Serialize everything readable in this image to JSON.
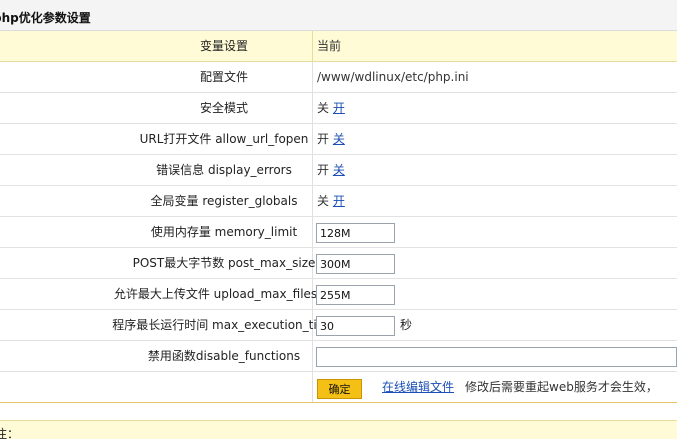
{
  "title": "php优化参数设置",
  "header": {
    "left": "变量设置",
    "right": "当前"
  },
  "rows": [
    {
      "label": "配置文件",
      "value": "/www/wdlinux/etc/php.ini"
    },
    {
      "label": "安全模式",
      "state": "关",
      "toggle": "开"
    },
    {
      "label": "URL打开文件 allow_url_fopen",
      "state": "开",
      "toggle": "关"
    },
    {
      "label": "错误信息 display_errors",
      "state": "开",
      "toggle": "关"
    },
    {
      "label": "全局变量 register_globals",
      "state": "关",
      "toggle": "开"
    },
    {
      "label": "使用内存量 memory_limit",
      "input": "128M"
    },
    {
      "label": "POST最大字节数 post_max_size",
      "input": "300M"
    },
    {
      "label": "允许最大上传文件 upload_max_filesize",
      "input": "255M"
    },
    {
      "label": "程序最长运行时间 max_execution_time",
      "input": "30",
      "unit": "秒"
    },
    {
      "label": "禁用函数disable_functions",
      "input": ""
    }
  ],
  "actions": {
    "submit": "确定",
    "edit_link": "在线编辑文件",
    "note": "修改后需要重起web服务才会生效，"
  },
  "remarks_label": "注："
}
